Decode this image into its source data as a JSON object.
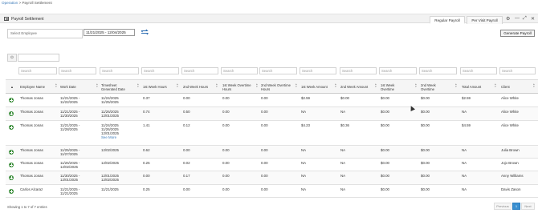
{
  "breadcrumb": {
    "parent": "Operation",
    "separator": ">",
    "current": "Payroll Settlement"
  },
  "panel": {
    "title": "Payroll Settlement"
  },
  "tabs": [
    {
      "label": "Regular Payroll",
      "active": true
    },
    {
      "label": "Per Visit Payroll",
      "active": false
    }
  ],
  "window_controls": {
    "settings": "⚙",
    "minimize": "—",
    "expand": "⤢",
    "close": "✕"
  },
  "toolbar": {
    "employee_placeholder": "Select Employee",
    "date_range": "11/21/2025 - 12/04/2025",
    "swap_icon": "swap-arrows-icon",
    "generate_label": "Generate Payroll"
  },
  "grid_tools": {
    "toggle_icon": "⊙"
  },
  "filter_placeholder": "Search",
  "columns": [
    "Employee Name",
    "Work Date",
    "Timesheet Generated Date",
    "1st Week Hours",
    "2nd Week Hours",
    "1st Week Overtime Hours",
    "2nd Week Overtime Hours",
    "1st Week Amount",
    "2nd Week Amount",
    "1st Week Overtime",
    "2nd Week Overtime",
    "Total Amount",
    "Client"
  ],
  "rows": [
    {
      "employee": "Thomas Jonas",
      "work_date": [
        "11/21/2025 -",
        "11/22/2025"
      ],
      "generated": [
        "11/24/2025",
        "11/25/2025"
      ],
      "w1_hours": "0.37",
      "w2_hours": "0.00",
      "w1_ot_hours": "0.00",
      "w2_ot_hours": "0.00",
      "w1_amount": "$2.59",
      "w2_amount": "$0.00",
      "w1_ot": "$0.00",
      "w2_ot": "$0.00",
      "total": "$2.59",
      "client": "Alice White",
      "see_more": ""
    },
    {
      "employee": "Thomas Jonas",
      "work_date": [
        "11/21/2025 -",
        "11/30/2025"
      ],
      "generated": [
        "11/26/2025",
        "12/01/2025"
      ],
      "w1_hours": "0.74",
      "w2_hours": "0.50",
      "w1_ot_hours": "0.00",
      "w2_ot_hours": "0.00",
      "w1_amount": "NA",
      "w2_amount": "NA",
      "w1_ot": "$0.00",
      "w2_ot": "$0.00",
      "total": "NA",
      "client": "Alice White",
      "see_more": ""
    },
    {
      "employee": "Thomas Jonas",
      "work_date": [
        "11/21/2025 -",
        "11/28/2025"
      ],
      "generated": [
        "11/24/2025",
        "11/26/2025",
        "12/01/2025"
      ],
      "w1_hours": "1.41",
      "w2_hours": "0.12",
      "w1_ot_hours": "0.00",
      "w2_ot_hours": "0.00",
      "w1_amount": "$4.23",
      "w2_amount": "$0.36",
      "w1_ot": "$0.00",
      "w2_ot": "$0.00",
      "total": "$4.59",
      "client": "Alice White",
      "see_more": "See More"
    },
    {
      "employee": "Thomas Jonas",
      "work_date": [
        "11/25/2025 -",
        "11/27/2025"
      ],
      "generated": [
        "12/02/2025"
      ],
      "w1_hours": "0.62",
      "w2_hours": "0.00",
      "w1_ot_hours": "0.00",
      "w2_ot_hours": "0.00",
      "w1_amount": "NA",
      "w2_amount": "NA",
      "w1_ot": "$0.00",
      "w2_ot": "$0.00",
      "total": "NA",
      "client": "Julia Brown",
      "see_more": ""
    },
    {
      "employee": "Thomas Jonas",
      "work_date": [
        "11/26/2025 -",
        "12/02/2025"
      ],
      "generated": [
        "12/02/2025"
      ],
      "w1_hours": "0.25",
      "w2_hours": "0.02",
      "w1_ot_hours": "0.00",
      "w2_ot_hours": "0.00",
      "w1_amount": "NA",
      "w2_amount": "NA",
      "w1_ot": "$0.00",
      "w2_ot": "$0.00",
      "total": "NA",
      "client": "Jojo Brown",
      "see_more": ""
    },
    {
      "employee": "Thomas Jonas",
      "work_date": [
        "11/30/2025 -",
        "12/01/2025"
      ],
      "generated": [
        "12/01/2025",
        "12/02/2025"
      ],
      "w1_hours": "0.00",
      "w2_hours": "0.17",
      "w1_ot_hours": "0.00",
      "w2_ot_hours": "0.00",
      "w1_amount": "NA",
      "w2_amount": "NA",
      "w1_ot": "$0.00",
      "w2_ot": "$0.00",
      "total": "NA",
      "client": "Anny Williams",
      "see_more": ""
    },
    {
      "employee": "Carlos Alcaraz",
      "work_date": [
        "11/21/2025 -",
        "11/21/2025"
      ],
      "generated": [
        "11/21/2025"
      ],
      "w1_hours": "0.25",
      "w2_hours": "0.00",
      "w1_ot_hours": "0.00",
      "w2_ot_hours": "0.00",
      "w1_amount": "NA",
      "w2_amount": "NA",
      "w1_ot": "$0.00",
      "w2_ot": "$0.00",
      "total": "NA",
      "client": "Davis Zason",
      "see_more": ""
    }
  ],
  "footer": {
    "info": "Showing 1 to 7 of 7 entries",
    "previous": "Previous",
    "page": "1",
    "next": "Next"
  },
  "colors": {
    "link": "#3a79b8",
    "add_icon": "#3d8f3d",
    "pager_active": "#3a8fd0"
  }
}
